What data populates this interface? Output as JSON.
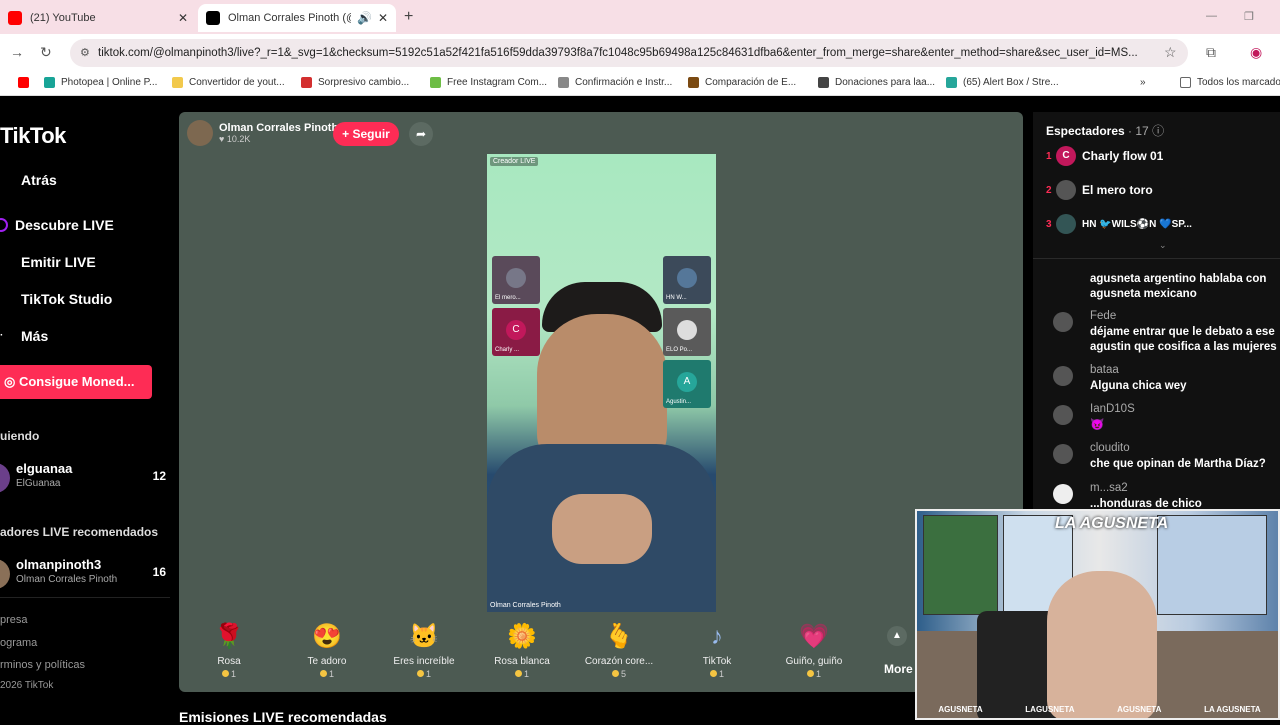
{
  "browser": {
    "tabs": [
      {
        "title": "(21) YouTube",
        "close": "✕"
      },
      {
        "title": "Olman Corrales Pinoth (@c",
        "close": "✕"
      }
    ],
    "new_tab": "+",
    "url": "tiktok.com/@olmanpinoth3/live?_r=1&_svg=1&checksum=5192c51a52f421fa516f59dda39793f8a7fc1048c95b69498a125c84631dfba6&enter_from_merge=share&enter_method=share&sec_user_id=MS...",
    "bookmarks": [
      "Photopea | Online P...",
      "Convertidor de yout...",
      "Sorpresivo cambio...",
      "Free Instagram Com...",
      "Confirmación e Instr...",
      "Comparación de E...",
      "Donaciones para laa...",
      "(65) Alert Box / Stre...",
      "Todos los marcado"
    ]
  },
  "sidebar": {
    "logo": "TikTok",
    "nav": [
      {
        "label": "Atrás"
      },
      {
        "label": "Descubre LIVE"
      },
      {
        "label": "Emitir LIVE"
      },
      {
        "label": "TikTok Studio"
      },
      {
        "label": "Más"
      }
    ],
    "cta": "Consigue Moned...",
    "following_title": "uiendo",
    "following": {
      "name": "elguanaa",
      "sub": "ElGuanaa",
      "count": "12"
    },
    "recommended_title": "adores LIVE recomendados",
    "recommended": {
      "name": "olmanpinoth3",
      "sub": "Olman Corrales Pinoth",
      "count": "16"
    },
    "footer": [
      "presa",
      "ograma",
      "rminos y políticas",
      "2026 TikTok"
    ]
  },
  "live": {
    "host_name": "Olman Corrales Pinoth",
    "likes": "♥ 10.2K",
    "follow": "+ Seguir",
    "video_label": "Creador LIVE",
    "video_footer": "Olman Corrales Pinoth",
    "guests": [
      {
        "name": "El mero...",
        "initial": ""
      },
      {
        "name": "Charly ...",
        "initial": "C"
      },
      {
        "name": "HN W...",
        "initial": ""
      },
      {
        "name": "ELO Po...",
        "initial": ""
      },
      {
        "name": "Agustin...",
        "initial": "A"
      }
    ],
    "gifts": [
      {
        "name": "Rosa",
        "price": "1",
        "icon": "🌹"
      },
      {
        "name": "Te adoro",
        "price": "1",
        "icon": "😍"
      },
      {
        "name": "Eres increíble",
        "price": "1",
        "icon": "🐱"
      },
      {
        "name": "Rosa blanca",
        "price": "1",
        "icon": "🌼"
      },
      {
        "name": "Corazón core...",
        "price": "5",
        "icon": "🫰"
      },
      {
        "name": "TikTok",
        "price": "1",
        "icon": "♪"
      },
      {
        "name": "Guiño, guiño",
        "price": "1",
        "icon": "💗"
      }
    ],
    "more": "More",
    "recommended_streams": "Emisiones LIVE recomendadas"
  },
  "chat": {
    "viewers_title": "Espectadores",
    "viewers_count": "· 17",
    "top_viewers": [
      {
        "rank": "1",
        "name": "Charly flow 01",
        "initial": "C",
        "color": "#c2185b"
      },
      {
        "rank": "2",
        "name": "El mero toro",
        "initial": "",
        "color": "#555"
      },
      {
        "rank": "3",
        "name": "HN 🐦WILS⚽N 💙SP...",
        "initial": "",
        "color": "#355"
      }
    ],
    "messages": [
      {
        "user": "",
        "text": "agusneta argentino hablaba con agusneta mexicano"
      },
      {
        "user": "Fede",
        "text": "déjame entrar que le debato a ese agustin que cosifica a las mujeres"
      },
      {
        "user": "bataa",
        "text": "Alguna chica wey"
      },
      {
        "user": "IanD10S",
        "text": "😈"
      },
      {
        "user": "cloudito",
        "text": "che que opinan de Martha Díaz?"
      },
      {
        "user": "m...sa2",
        "text": "...honduras de chico"
      }
    ]
  },
  "webcam": {
    "brand": "LA AGUSNETA",
    "socials": [
      "AGUSNETA",
      "LAGUSNETA",
      "AGUSNETA",
      "LA AGUSNETA"
    ]
  }
}
